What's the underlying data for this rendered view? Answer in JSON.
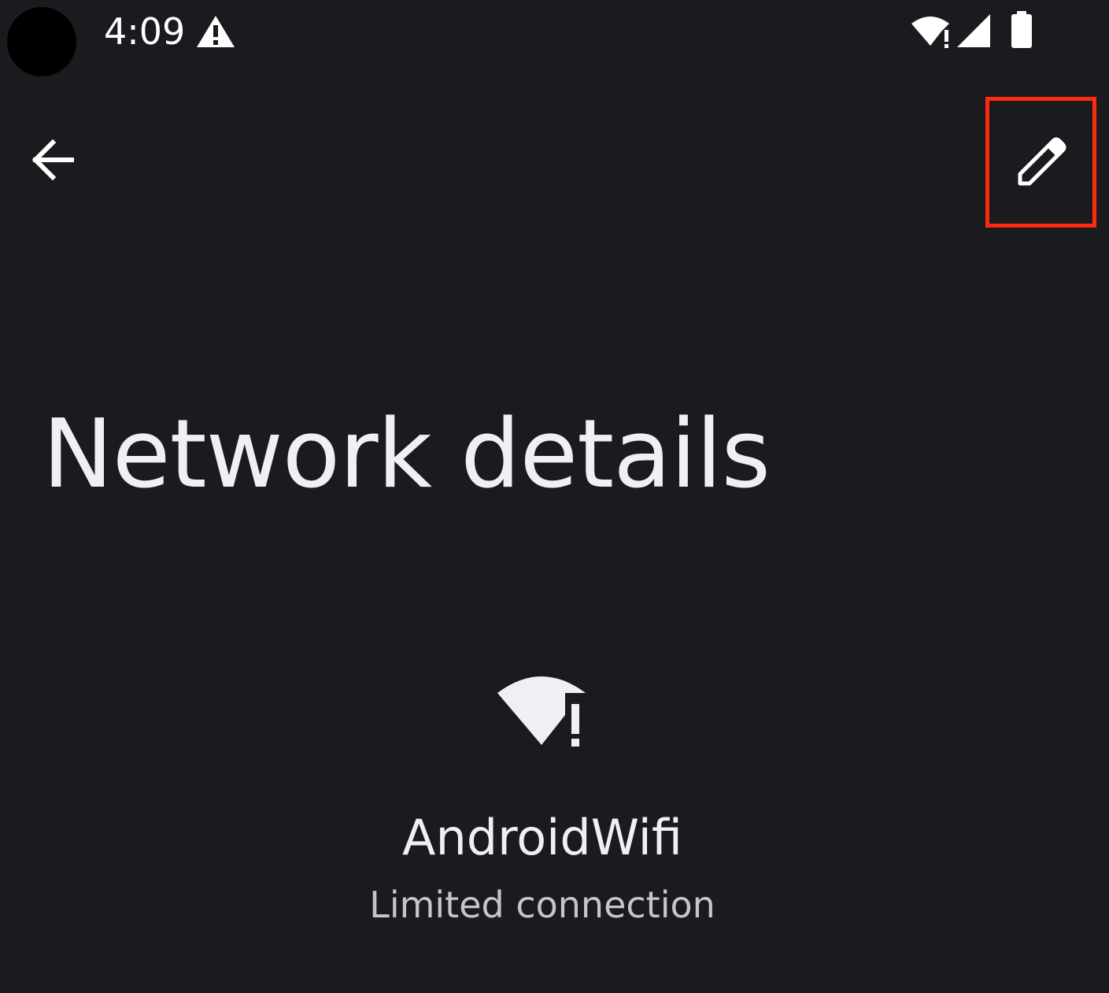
{
  "status_bar": {
    "time": "4:09",
    "icons": [
      "alert-icon",
      "wifi-warning-icon",
      "cellular-signal-icon",
      "battery-icon"
    ]
  },
  "toolbar": {
    "back_icon": "arrow-back-icon",
    "edit_icon": "pencil-icon"
  },
  "page": {
    "title": "Network details"
  },
  "network": {
    "icon": "wifi-warning-icon",
    "name": "AndroidWifi",
    "status": "Limited connection"
  },
  "colors": {
    "background": "#1b1b1f",
    "text_primary": "#f1eff4",
    "text_secondary": "#c6c5cf",
    "highlight": "#ff2a0d"
  }
}
